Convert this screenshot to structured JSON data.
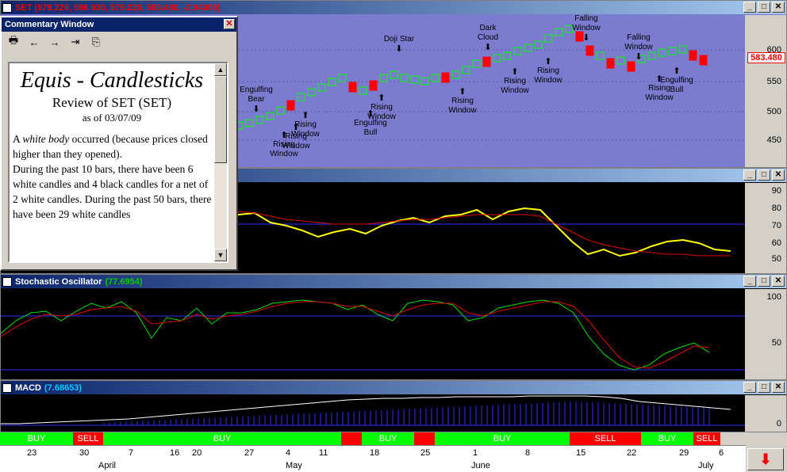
{
  "price_pane": {
    "title": "SET (579.220, 586.030, 579.220, 583.480, -2.94000)",
    "last_price": "583.480",
    "ticks": [
      "600",
      "550",
      "500",
      "450"
    ]
  },
  "rsi_pane": {
    "ticks": [
      "90",
      "80",
      "70",
      "60",
      "50"
    ]
  },
  "stoch_pane": {
    "title": "Stochastic Oscillator",
    "value": "(77.6954)",
    "ticks": [
      "100",
      "50"
    ]
  },
  "macd_pane": {
    "title": "MACD",
    "value": "(7.68653)",
    "ticks": [
      "0"
    ]
  },
  "window_buttons": {
    "minimize": "_",
    "restore": "□",
    "close": "✕"
  },
  "commentary": {
    "title": "Commentary Window",
    "heading": "Equis - Candlesticks",
    "review": "Review of SET (SET)",
    "as_of": "as of 03/07/09",
    "text_before": "A ",
    "text_italic": "white body",
    "text_after": " occurred (because prices closed higher than they opened).",
    "text_2": "During the past 10 bars, there have been 6 white candles and 4 black candles for a net of 2 white candles.  During the past 50 bars, there have been 29 white candles"
  },
  "annotations": [
    {
      "text": "Engulfing Bear",
      "arrow": "down"
    },
    {
      "text": "Rising Window",
      "arrow": "up"
    },
    {
      "text": "Rising Window",
      "arrow": "up"
    },
    {
      "text": "Rising Window",
      "arrow": "up"
    },
    {
      "text": "Doji Star",
      "arrow": "down"
    },
    {
      "text": "Rising Window",
      "arrow": "up"
    },
    {
      "text": "Engulfing Bull",
      "arrow": "up"
    },
    {
      "text": "Dark Cloud",
      "arrow": "down"
    },
    {
      "text": "Rising Window",
      "arrow": "up"
    },
    {
      "text": "Rising Window",
      "arrow": "up"
    },
    {
      "text": "Rising Window",
      "arrow": "up"
    },
    {
      "text": "Falling Window",
      "arrow": "down"
    },
    {
      "text": "Falling Window",
      "arrow": "down"
    },
    {
      "text": "Rising Window",
      "arrow": "up"
    },
    {
      "text": "Engulfing Bull",
      "arrow": "up"
    }
  ],
  "signals": [
    {
      "label": "BUY",
      "color": "#00ff00"
    },
    {
      "label": "SELL",
      "color": "#ff0000"
    },
    {
      "label": "BUY",
      "color": "#00ff00"
    },
    {
      "label": "",
      "color": "#ff0000"
    },
    {
      "label": "BUY",
      "color": "#00ff00"
    },
    {
      "label": "",
      "color": "#ff0000"
    },
    {
      "label": "BUY",
      "color": "#00ff00"
    },
    {
      "label": "SELL",
      "color": "#ff0000"
    },
    {
      "label": "BUY",
      "color": "#00ff00"
    },
    {
      "label": "SELL",
      "color": "#ff0000"
    }
  ],
  "dates": [
    "23",
    "30",
    "7",
    "16",
    "20",
    "27",
    "4",
    "11",
    "18",
    "25",
    "1",
    "8",
    "15",
    "22",
    "29",
    "6"
  ],
  "months": [
    "April",
    "May",
    "June",
    "July"
  ],
  "colors": {
    "price_bg": "#7b7bd0",
    "indicator_bg": "#000000",
    "bull": "#00ff00",
    "bear": "#ff0000",
    "rsi_line": "#ffff00",
    "ma_line": "#ff0000"
  }
}
